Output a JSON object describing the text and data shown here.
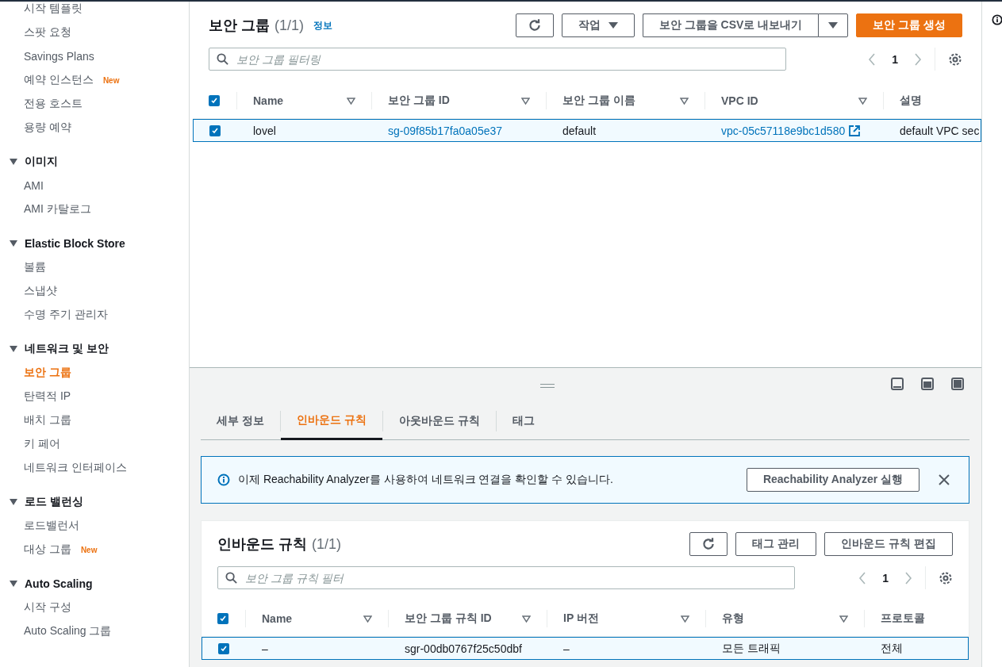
{
  "sidebar": {
    "top_items": [
      {
        "label": "시작 템플릿",
        "selected": false
      },
      {
        "label": "스팟 요청",
        "selected": false
      },
      {
        "label": "Savings Plans",
        "selected": false
      },
      {
        "label": "예약 인스턴스",
        "selected": false,
        "badge": "New"
      },
      {
        "label": "전용 호스트",
        "selected": false
      },
      {
        "label": "용량 예약",
        "selected": false
      }
    ],
    "sections": [
      {
        "title": "이미지",
        "expanded": true,
        "items": [
          {
            "label": "AMI",
            "selected": false
          },
          {
            "label": "AMI 카탈로그",
            "selected": false
          }
        ]
      },
      {
        "title": "Elastic Block Store",
        "expanded": true,
        "items": [
          {
            "label": "볼륨",
            "selected": false
          },
          {
            "label": "스냅샷",
            "selected": false
          },
          {
            "label": "수명 주기 관리자",
            "selected": false
          }
        ]
      },
      {
        "title": "네트워크 및 보안",
        "expanded": true,
        "items": [
          {
            "label": "보안 그룹",
            "selected": true
          },
          {
            "label": "탄력적 IP",
            "selected": false
          },
          {
            "label": "배치 그룹",
            "selected": false
          },
          {
            "label": "키 페어",
            "selected": false
          },
          {
            "label": "네트워크 인터페이스",
            "selected": false
          }
        ]
      },
      {
        "title": "로드 밸런싱",
        "expanded": true,
        "items": [
          {
            "label": "로드밸런서",
            "selected": false
          },
          {
            "label": "대상 그룹",
            "selected": false,
            "badge": "New"
          }
        ]
      },
      {
        "title": "Auto Scaling",
        "expanded": true,
        "items": [
          {
            "label": "시작 구성",
            "selected": false
          },
          {
            "label": "Auto Scaling 그룹",
            "selected": false
          }
        ]
      }
    ]
  },
  "security_groups": {
    "title": "보안 그룹",
    "count": "(1/1)",
    "info_link": "정보",
    "buttons": [
      {
        "kind": "refresh"
      },
      {
        "kind": "dropdown",
        "label": "작업"
      },
      {
        "kind": "split",
        "label": "보안 그룹을 CSV로 내보내기"
      },
      {
        "kind": "primary",
        "label": "보안 그룹 생성"
      }
    ],
    "filter": {
      "placeholder": "보안 그룹 필터링"
    },
    "page": "1",
    "table": {
      "all_selected": true,
      "columns": [
        "Name",
        "보안 그룹 ID",
        "보안 그룹 이름",
        "VPC ID",
        "설명"
      ],
      "rows": [
        {
          "selected": true,
          "cells": [
            {
              "text": "lovel"
            },
            {
              "kind": "link",
              "text": "sg-09f85b17fa0a05e37"
            },
            {
              "text": "default"
            },
            {
              "kind": "external_link",
              "text": "vpc-05c57118e9bc1d580"
            },
            {
              "text": "default VPC sec"
            }
          ]
        }
      ]
    }
  },
  "details_panel": {
    "tabs": [
      {
        "label": "세부 정보",
        "selected": false
      },
      {
        "label": "인바운드 규칙",
        "selected": true
      },
      {
        "label": "아웃바운드 규칙",
        "selected": false
      },
      {
        "label": "태그",
        "selected": false
      }
    ],
    "alert": {
      "text": "이제 Reachability Analyzer를 사용하여 네트워크 연결을 확인할 수 있습니다.",
      "button": "Reachability Analyzer 실행"
    },
    "inbound_rules": {
      "title": "인바운드 규칙",
      "count": "(1/1)",
      "buttons": [
        {
          "kind": "refresh"
        },
        {
          "kind": "normal",
          "label": "태그 관리"
        },
        {
          "kind": "normal",
          "label": "인바운드 규칙 편집"
        }
      ],
      "filter": {
        "placeholder": "보안 그룹 규칙 필터"
      },
      "page": "1",
      "table": {
        "all_selected": true,
        "columns": [
          "Name",
          "보안 그룹 규칙 ID",
          "IP 버전",
          "유형",
          "프로토콜"
        ],
        "rows": [
          {
            "selected": true,
            "cells": [
              {
                "text": "–"
              },
              {
                "text": "sgr-00db0767f25c50dbf"
              },
              {
                "text": "–"
              },
              {
                "text": "모든 트래픽"
              },
              {
                "text": "전체"
              }
            ]
          }
        ]
      }
    }
  }
}
